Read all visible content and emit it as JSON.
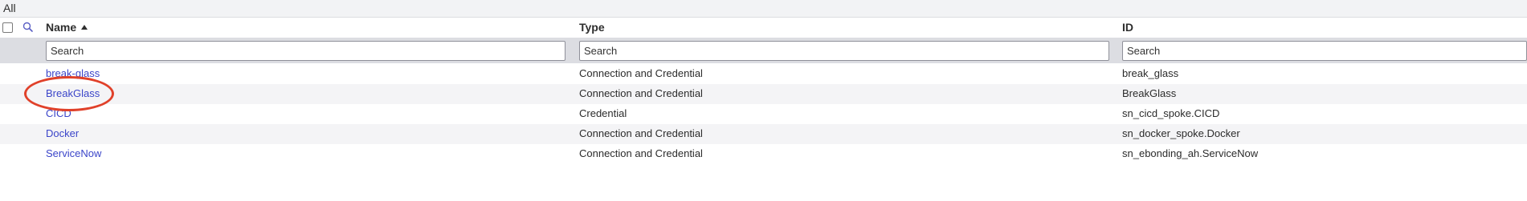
{
  "breadcrumb": {
    "label": "All"
  },
  "columns": {
    "name": "Name",
    "type": "Type",
    "id": "ID"
  },
  "filters": {
    "name_placeholder": "Search",
    "type_placeholder": "Search",
    "id_placeholder": "Search"
  },
  "rows": [
    {
      "name": "break-glass",
      "type": "Connection and Credential",
      "id": "break_glass"
    },
    {
      "name": "BreakGlass",
      "type": "Connection and Credential",
      "id": "BreakGlass"
    },
    {
      "name": "CICD",
      "type": "Credential",
      "id": "sn_cicd_spoke.CICD"
    },
    {
      "name": "Docker",
      "type": "Connection and Credential",
      "id": "sn_docker_spoke.Docker"
    },
    {
      "name": "ServiceNow",
      "type": "Connection and Credential",
      "id": "sn_ebonding_ah.ServiceNow"
    }
  ],
  "colors": {
    "link": "#3b45c9",
    "annotation": "#e0412a",
    "filter_bar": "#dcdde2"
  }
}
